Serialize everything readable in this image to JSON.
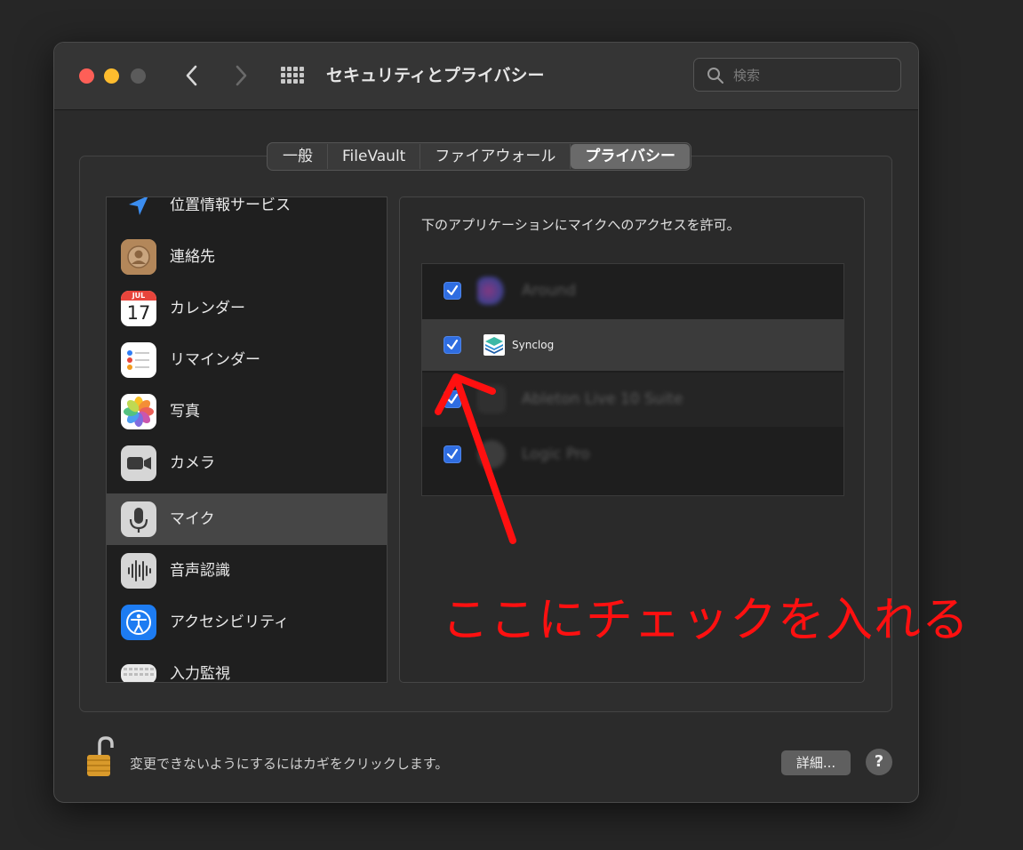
{
  "window": {
    "title": "セキュリティとプライバシー",
    "search_placeholder": "検索"
  },
  "tabs": [
    {
      "label": "一般",
      "active": false
    },
    {
      "label": "FileVault",
      "active": false
    },
    {
      "label": "ファイアウォール",
      "active": false
    },
    {
      "label": "プライバシー",
      "active": true
    }
  ],
  "sidebar": {
    "items": [
      {
        "label": "位置情報サービス",
        "icon": "location-arrow-icon"
      },
      {
        "label": "連絡先",
        "icon": "contacts-icon"
      },
      {
        "label": "カレンダー",
        "icon": "calendar-icon",
        "month": "JUL",
        "day": "17"
      },
      {
        "label": "リマインダー",
        "icon": "reminders-icon"
      },
      {
        "label": "写真",
        "icon": "photos-icon"
      },
      {
        "label": "カメラ",
        "icon": "camera-icon"
      },
      {
        "label": "マイク",
        "icon": "microphone-icon",
        "selected": true
      },
      {
        "label": "音声認識",
        "icon": "speech-recognition-icon"
      },
      {
        "label": "アクセシビリティ",
        "icon": "accessibility-icon"
      },
      {
        "label": "入力監視",
        "icon": "keyboard-icon"
      }
    ]
  },
  "content": {
    "heading": "下のアプリケーションにマイクへのアクセスを許可。",
    "apps": [
      {
        "name": "Around",
        "checked": true,
        "blurred": true
      },
      {
        "name": "Synclog",
        "checked": true,
        "blurred": false,
        "highlighted": true
      },
      {
        "name": "Ableton Live 10 Suite",
        "checked": true,
        "blurred": true
      },
      {
        "name": "Logic Pro",
        "checked": true,
        "blurred": true
      }
    ]
  },
  "footer": {
    "lock_text": "変更できないようにするにはカギをクリックします。",
    "details_button": "詳細...",
    "help_button": "?"
  },
  "annotation": {
    "text": "ここにチェックを入れる",
    "color": "#ff1010"
  },
  "colors": {
    "accent": "#2f6de1",
    "traffic_red": "#fe5f57",
    "traffic_yellow": "#febc2e"
  }
}
